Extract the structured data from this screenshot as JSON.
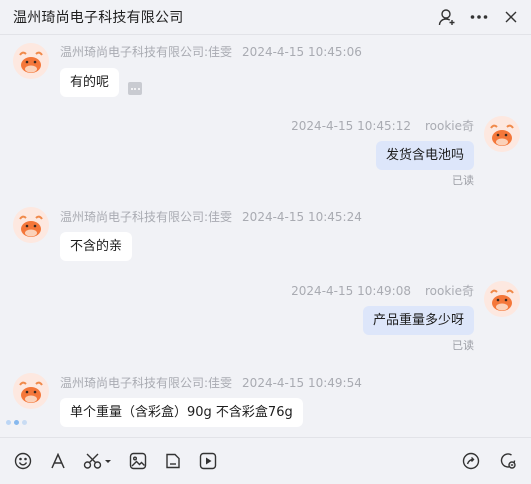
{
  "header": {
    "title": "温州琦尚电子科技有限公司"
  },
  "messages": [
    {
      "sender": "温州琦尚电子科技有限公司:佳雯",
      "time": "2024-4-15 10:45:06",
      "text": "有的呢"
    },
    {
      "sender": "rookie奇",
      "time": "2024-4-15 10:45:12",
      "text": "发货含电池吗",
      "read": "已读"
    },
    {
      "sender": "温州琦尚电子科技有限公司:佳雯",
      "time": "2024-4-15 10:45:24",
      "text": "不含的亲"
    },
    {
      "sender": "rookie奇",
      "time": "2024-4-15 10:49:08",
      "text": "产品重量多少呀",
      "read": "已读"
    },
    {
      "sender": "温州琦尚电子科技有限公司:佳雯",
      "time": "2024-4-15 10:49:54",
      "text": "单个重量（含彩盒）90g  不含彩盒76g"
    }
  ],
  "colors": {
    "accent": "#dde6fa",
    "avatar_bg": "#fde8e0",
    "typing_dots": [
      "#bcd6f5",
      "#86b8ee",
      "#c9dcf3"
    ]
  }
}
